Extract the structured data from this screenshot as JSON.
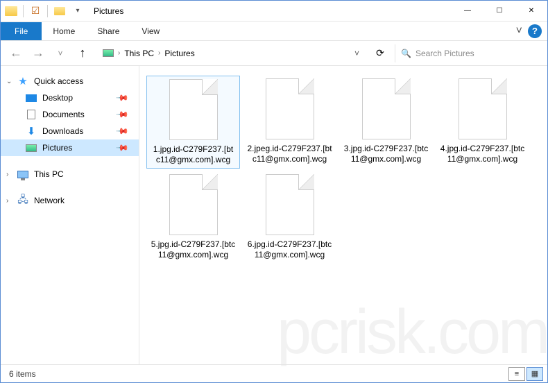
{
  "window": {
    "title": "Pictures",
    "controls": {
      "min": "—",
      "max": "☐",
      "close": "✕"
    }
  },
  "ribbon": {
    "file": "File",
    "tabs": [
      "Home",
      "Share",
      "View"
    ],
    "expand": "˅",
    "help": "?"
  },
  "nav": {
    "back": "←",
    "fwd": "→",
    "recent": "˅",
    "up": "↑",
    "breadcrumb_items": [
      "This PC",
      "Pictures"
    ],
    "bc_dropdown": "˅",
    "refresh": "⟳",
    "search_placeholder": "Search Pictures",
    "search_icon": "🔍"
  },
  "sidebar": {
    "quick": {
      "label": "Quick access"
    },
    "pinned": [
      {
        "label": "Desktop"
      },
      {
        "label": "Documents"
      },
      {
        "label": "Downloads"
      },
      {
        "label": "Pictures",
        "selected": true
      }
    ],
    "thispc": {
      "label": "This PC"
    },
    "network": {
      "label": "Network"
    }
  },
  "files": [
    {
      "name": "1.jpg.id-C279F237.[btc11@gmx.com].wcg",
      "selected": true
    },
    {
      "name": "2.jpeg.id-C279F237.[btc11@gmx.com].wcg"
    },
    {
      "name": "3.jpg.id-C279F237.[btc11@gmx.com].wcg"
    },
    {
      "name": "4.jpg.id-C279F237.[btc11@gmx.com].wcg"
    },
    {
      "name": "5.jpg.id-C279F237.[btc11@gmx.com].wcg"
    },
    {
      "name": "6.jpg.id-C279F237.[btc11@gmx.com].wcg"
    }
  ],
  "status": {
    "count": "6 items",
    "view_details": "≡",
    "view_icons": "▦"
  },
  "watermark": "pcrisk.com"
}
